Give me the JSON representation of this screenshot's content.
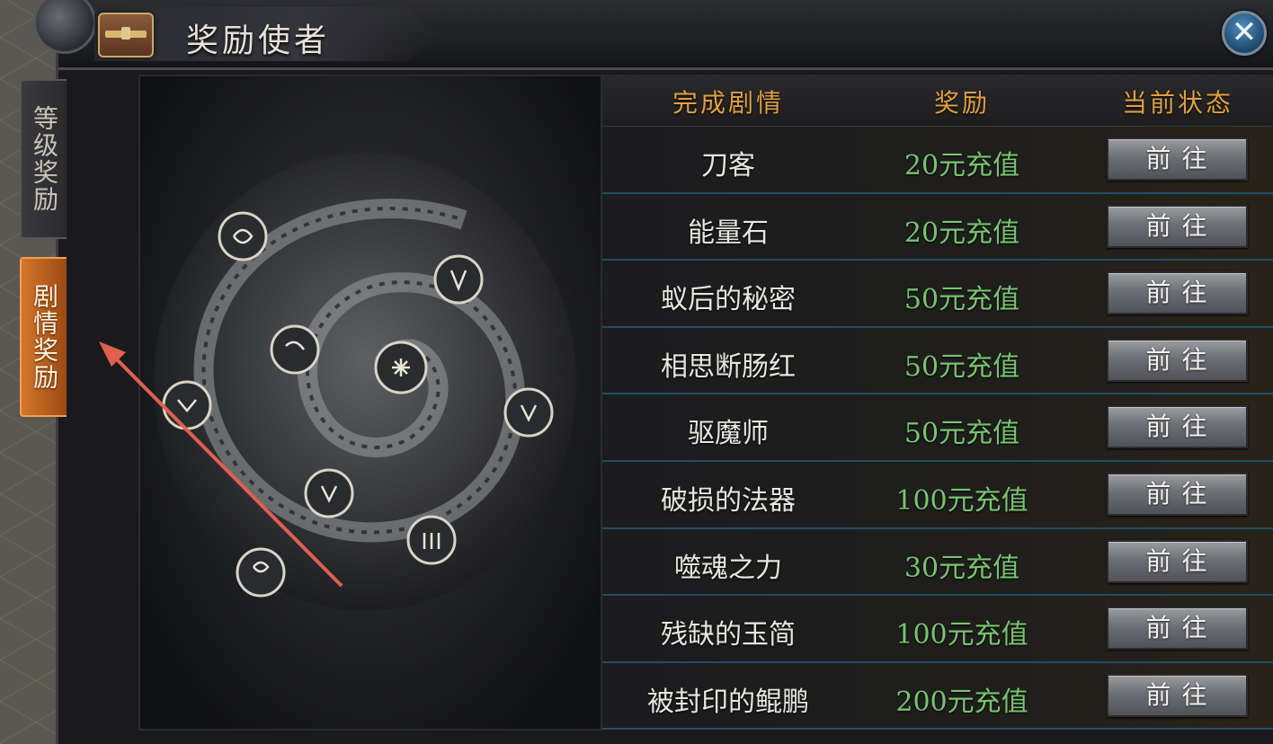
{
  "window": {
    "title": "奖励使者",
    "close_label": "✕"
  },
  "side_tabs": [
    {
      "label": "等级奖励",
      "active": false
    },
    {
      "label": "剧情奖励",
      "active": true
    }
  ],
  "table": {
    "headers": {
      "story": "完成剧情",
      "reward": "奖励",
      "status": "当前状态"
    },
    "rows": [
      {
        "story": "刀客",
        "reward": "20元充值",
        "action": "前往"
      },
      {
        "story": "能量石",
        "reward": "20元充值",
        "action": "前往"
      },
      {
        "story": "蚁后的秘密",
        "reward": "50元充值",
        "action": "前往"
      },
      {
        "story": "相思断肠红",
        "reward": "50元充值",
        "action": "前往"
      },
      {
        "story": "驱魔师",
        "reward": "50元充值",
        "action": "前往"
      },
      {
        "story": "破损的法器",
        "reward": "100元充值",
        "action": "前往"
      },
      {
        "story": "噬魂之力",
        "reward": "30元充值",
        "action": "前往"
      },
      {
        "story": "残缺的玉简",
        "reward": "100元充值",
        "action": "前往"
      },
      {
        "story": "被封印的鲲鹏",
        "reward": "200元充值",
        "action": "前往"
      }
    ]
  },
  "colors": {
    "header_text": "#e0a040",
    "reward_text": "#78c470",
    "active_tab": "#d4762a",
    "annotation_arrow": "#e0604c"
  },
  "icons": {
    "title": "treasure-chest-icon",
    "close": "close-icon",
    "annotation": "arrow-annotation"
  }
}
